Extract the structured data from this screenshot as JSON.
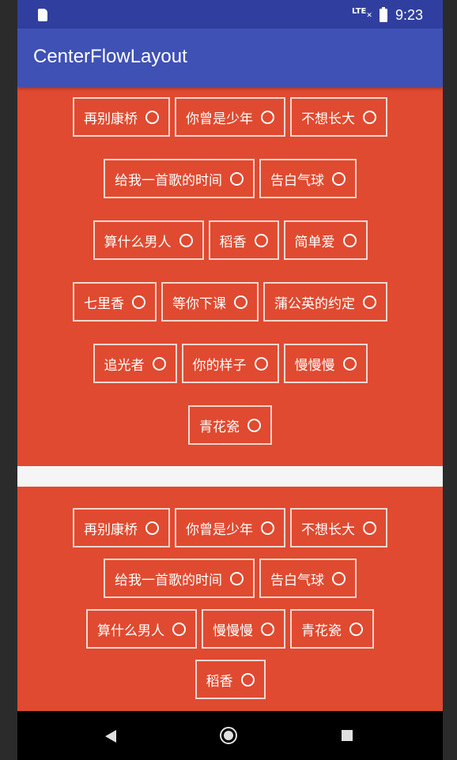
{
  "status_bar": {
    "network": "LTE",
    "time": "9:23"
  },
  "app_bar": {
    "title": "CenterFlowLayout"
  },
  "panel1": {
    "rows": [
      [
        "再别康桥",
        "你曾是少年",
        "不想长大"
      ],
      [
        "给我一首歌的时间",
        "告白气球"
      ],
      [
        "算什么男人",
        "稻香",
        "简单爱"
      ],
      [
        "七里香",
        "等你下课",
        "蒲公英的约定"
      ],
      [
        "追光者",
        "你的样子",
        "慢慢慢"
      ],
      [
        "青花瓷"
      ]
    ]
  },
  "panel2": {
    "rows": [
      [
        "再别康桥",
        "你曾是少年",
        "不想长大"
      ],
      [
        "给我一首歌的时间",
        "告白气球"
      ],
      [
        "算什么男人",
        "慢慢慢",
        "青花瓷"
      ],
      [
        "稻香"
      ]
    ]
  },
  "nav_bar": {
    "back_icon": "back-icon",
    "home_icon": "home-icon",
    "recents_icon": "recents-icon"
  }
}
